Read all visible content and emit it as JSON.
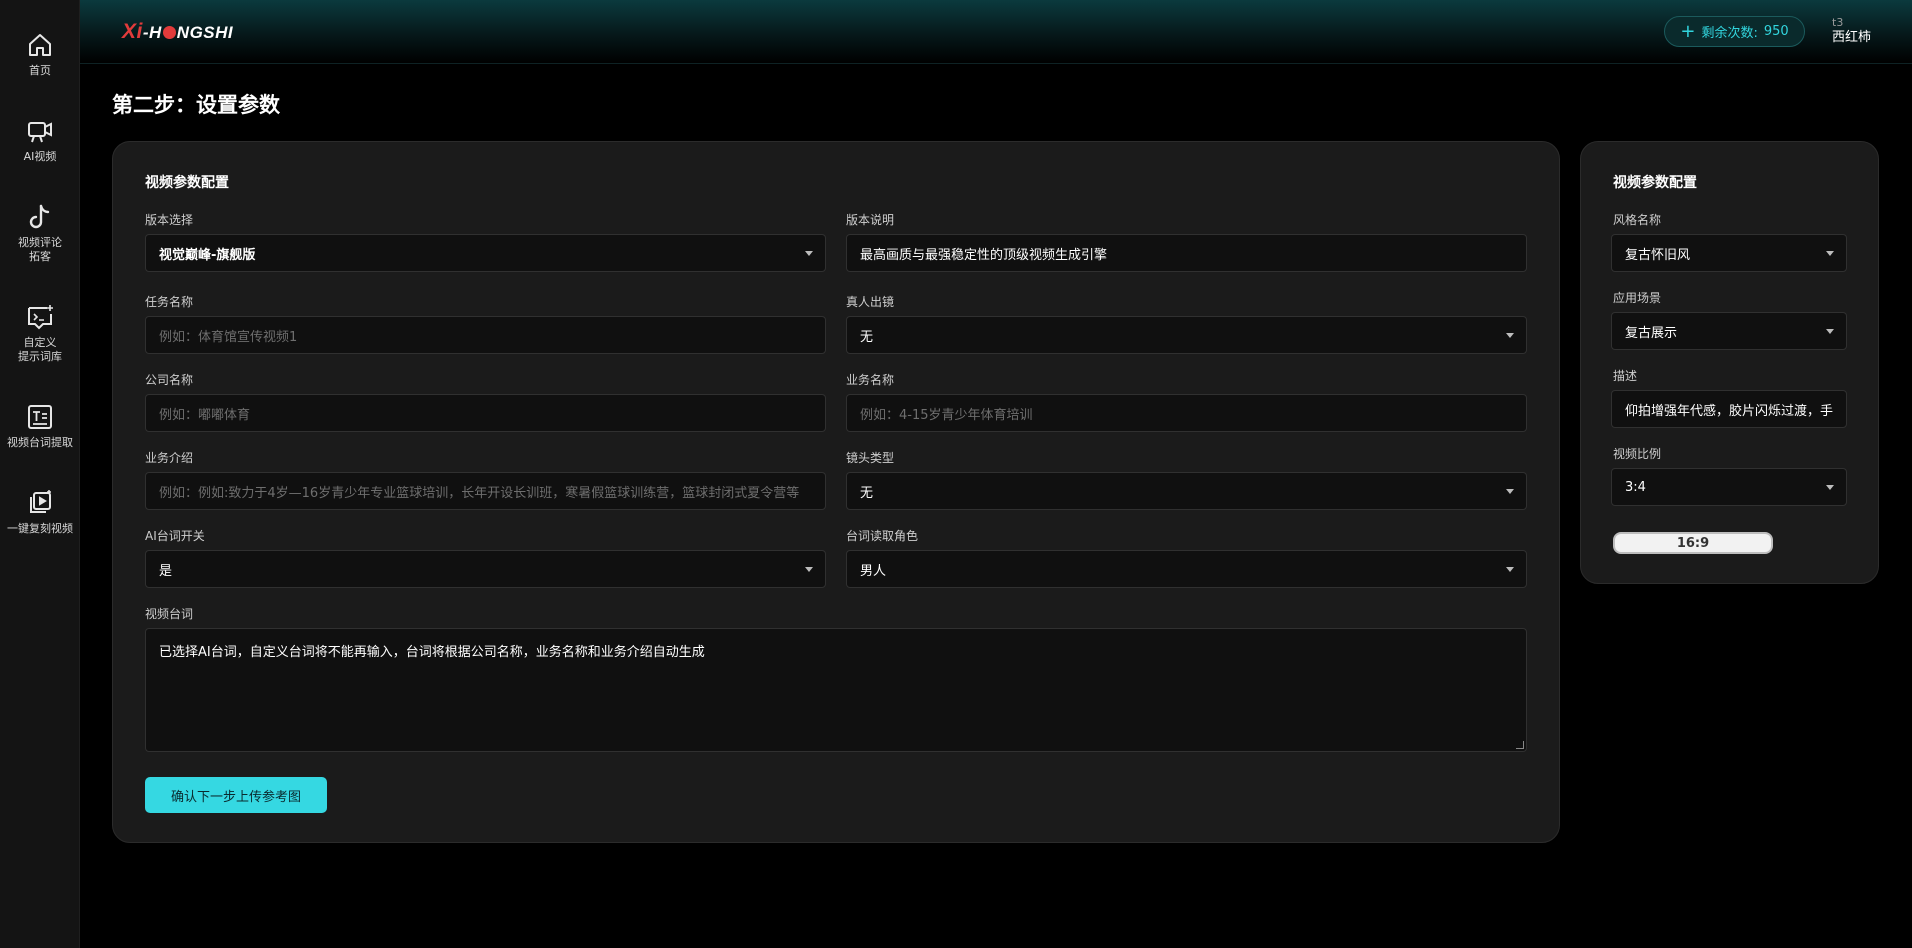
{
  "sidebar": {
    "items": [
      {
        "label": "首页",
        "icon": "home-icon"
      },
      {
        "label": "AI视频",
        "icon": "video-camera-icon"
      },
      {
        "label": "视频评论\n拓客",
        "icon": "tiktok-icon"
      },
      {
        "label": "自定义\n提示词库",
        "icon": "prompt-terminal-icon"
      },
      {
        "label": "视频台词提取",
        "icon": "text-extract-icon"
      },
      {
        "label": "一键复刻视频",
        "icon": "video-clone-icon"
      }
    ]
  },
  "header": {
    "logo": {
      "part1": "Xi",
      "part2": "-H",
      "part3": "NGSHI"
    },
    "credits": {
      "label": "剩余次数:",
      "value": "950"
    },
    "user": {
      "id": "t3",
      "name": "西红柿"
    }
  },
  "page_title": "第二步：设置参数",
  "main_panel": {
    "title": "视频参数配置",
    "version_select": {
      "label": "版本选择",
      "value": "视觉巅峰-旗舰版"
    },
    "version_desc": {
      "label": "版本说明",
      "value": "最高画质与最强稳定性的顶级视频生成引擎"
    },
    "task_name": {
      "label": "任务名称",
      "placeholder": "例如：体育馆宣传视频1"
    },
    "real_person": {
      "label": "真人出镜",
      "value": "无"
    },
    "company_name": {
      "label": "公司名称",
      "placeholder": "例如：嘟嘟体育"
    },
    "business_name": {
      "label": "业务名称",
      "placeholder": "例如：4-15岁青少年体育培训"
    },
    "business_intro": {
      "label": "业务介绍",
      "placeholder": "例如：例如:致力于4岁—16岁青少年专业篮球培训，长年开设长训班，寒暑假篮球训练营，篮球封闭式夏令营等"
    },
    "shot_type": {
      "label": "镜头类型",
      "value": "无"
    },
    "ai_script": {
      "label": "AI台词开关",
      "value": "是"
    },
    "voice_role": {
      "label": "台词读取角色",
      "value": "男人"
    },
    "script": {
      "label": "视频台词",
      "value": "已选择AI台词，自定义台词将不能再输入，台词将根据公司名称，业务名称和业务介绍自动生成"
    },
    "confirm_button": "确认下一步上传参考图"
  },
  "side_panel": {
    "title": "视频参数配置",
    "style_name": {
      "label": "风格名称",
      "value": "复古怀旧风"
    },
    "scene": {
      "label": "应用场景",
      "value": "复古展示"
    },
    "description": {
      "label": "描述",
      "value": "仰拍增强年代感，胶片闪烁过渡，手"
    },
    "ratio": {
      "label": "视频比例",
      "value": "3:4"
    },
    "ratio_option": "16:9"
  },
  "colors": {
    "accent": "#35d8e2",
    "logo_red": "#e23b3b",
    "panel_bg": "#1b1b1b"
  }
}
